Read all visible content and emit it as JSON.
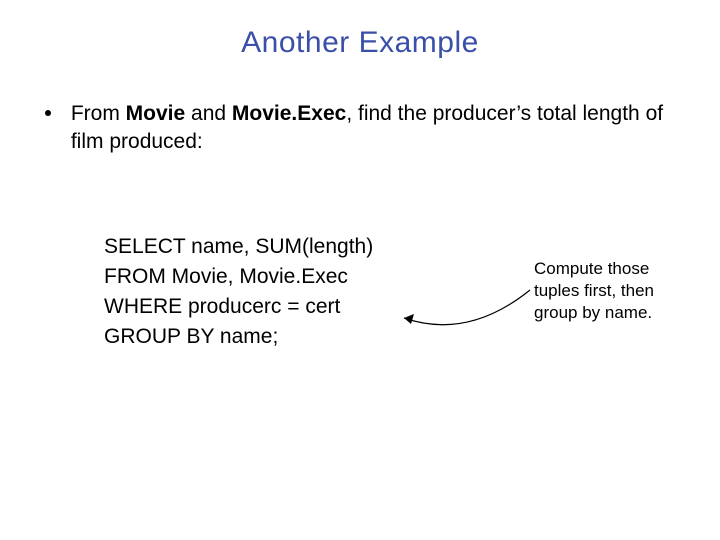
{
  "title": "Another Example",
  "bullet": {
    "prefix": "From ",
    "movie": "Movie",
    "and": " and ",
    "movieexec": "Movie.Exec",
    "rest": ", find the producer’s total length of film produced:"
  },
  "sql": {
    "l1": "SELECT name, SUM(length)",
    "l2": "FROM Movie, Movie.Exec",
    "l3": "WHERE producerc = cert",
    "l4": "GROUP BY name;"
  },
  "note": "Compute those tuples first, then group by name."
}
